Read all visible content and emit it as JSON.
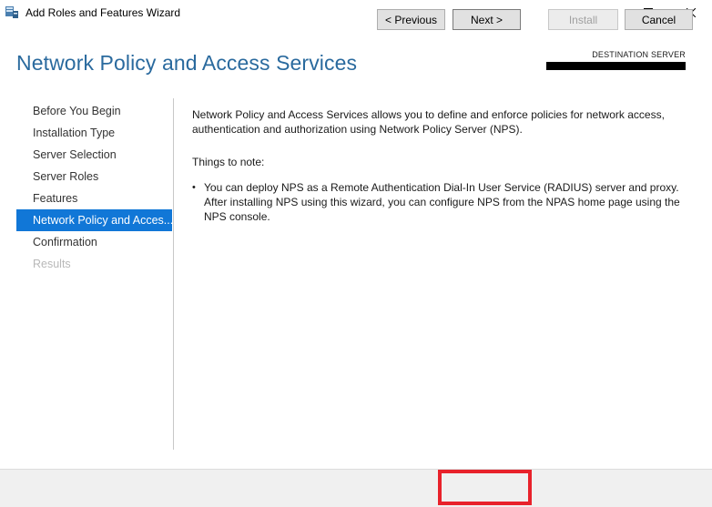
{
  "window": {
    "title": "Add Roles and Features Wizard",
    "icons": {
      "app": "server-manager-icon",
      "minimize": "minimize-icon",
      "maximize": "maximize-icon",
      "close": "close-icon"
    }
  },
  "header": {
    "page_title": "Network Policy and Access Services",
    "destination_label": "DESTINATION SERVER",
    "destination_value_redacted": true
  },
  "sidebar": {
    "items": [
      {
        "label": "Before You Begin",
        "state": "normal"
      },
      {
        "label": "Installation Type",
        "state": "normal"
      },
      {
        "label": "Server Selection",
        "state": "normal"
      },
      {
        "label": "Server Roles",
        "state": "normal"
      },
      {
        "label": "Features",
        "state": "normal"
      },
      {
        "label": "Network Policy and Acces...",
        "state": "active"
      },
      {
        "label": "Confirmation",
        "state": "normal"
      },
      {
        "label": "Results",
        "state": "disabled"
      }
    ]
  },
  "content": {
    "intro": "Network Policy and Access Services allows you to define and enforce policies for network access, authentication and authorization using Network Policy Server (NPS).",
    "notes_heading": "Things to note:",
    "bullets": [
      "You can deploy NPS as a Remote Authentication Dial-In User Service (RADIUS) server and proxy. After installing NPS using this wizard,  you can configure NPS from the NPAS home page using the NPS console."
    ]
  },
  "footer": {
    "previous_label": "< Previous",
    "next_label": "Next >",
    "install_label": "Install",
    "cancel_label": "Cancel",
    "install_enabled": false,
    "highlighted_button": "Next >"
  },
  "colors": {
    "title_blue": "#2a6a9e",
    "active_nav": "#1177d7",
    "highlight_red": "#e8222b"
  }
}
